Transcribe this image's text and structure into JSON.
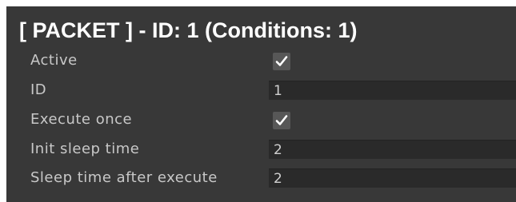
{
  "header": {
    "title": "[ PACKET ] - ID: 1 (Conditions: 1)"
  },
  "fields": {
    "active": {
      "label": "Active",
      "checked": true,
      "icon": "checkmark-icon"
    },
    "id": {
      "label": "ID",
      "value": "1"
    },
    "execute_once": {
      "label": "Execute once",
      "checked": true,
      "icon": "checkmark-icon"
    },
    "init_sleep_time": {
      "label": "Init sleep time",
      "value": "2"
    },
    "sleep_time_after_execute": {
      "label": "Sleep time after execute",
      "value": "2"
    }
  },
  "colors": {
    "panel_background": "#383838",
    "field_background": "#2a2a2a",
    "checkbox_background": "#575757",
    "label_text": "#c8c8c8",
    "header_text": "#ffffff"
  }
}
